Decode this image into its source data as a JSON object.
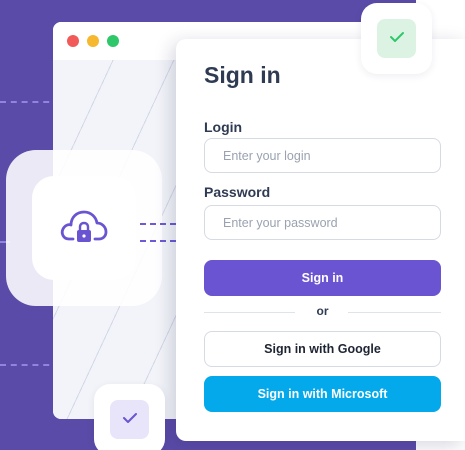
{
  "window": {
    "traffic_lights": [
      "#f25a5a",
      "#f5b82e",
      "#2ec76a"
    ]
  },
  "signin": {
    "title": "Sign in",
    "login_label": "Login",
    "login_placeholder": "Enter your login",
    "password_label": "Password",
    "password_placeholder": "Enter your password",
    "submit_label": "Sign in",
    "divider_text": "or",
    "google_label": "Sign in with Google",
    "microsoft_label": "Sign in with Microsoft"
  },
  "decor": {
    "cloud_icon": "cloud-lock-icon",
    "top_badge_icon": "check-icon",
    "bottom_badge_icon": "check-icon"
  },
  "colors": {
    "primary": "#6a54d2",
    "microsoft": "#03a9eb",
    "backdrop": "#5b4ba8",
    "success": "#2ec76a"
  }
}
